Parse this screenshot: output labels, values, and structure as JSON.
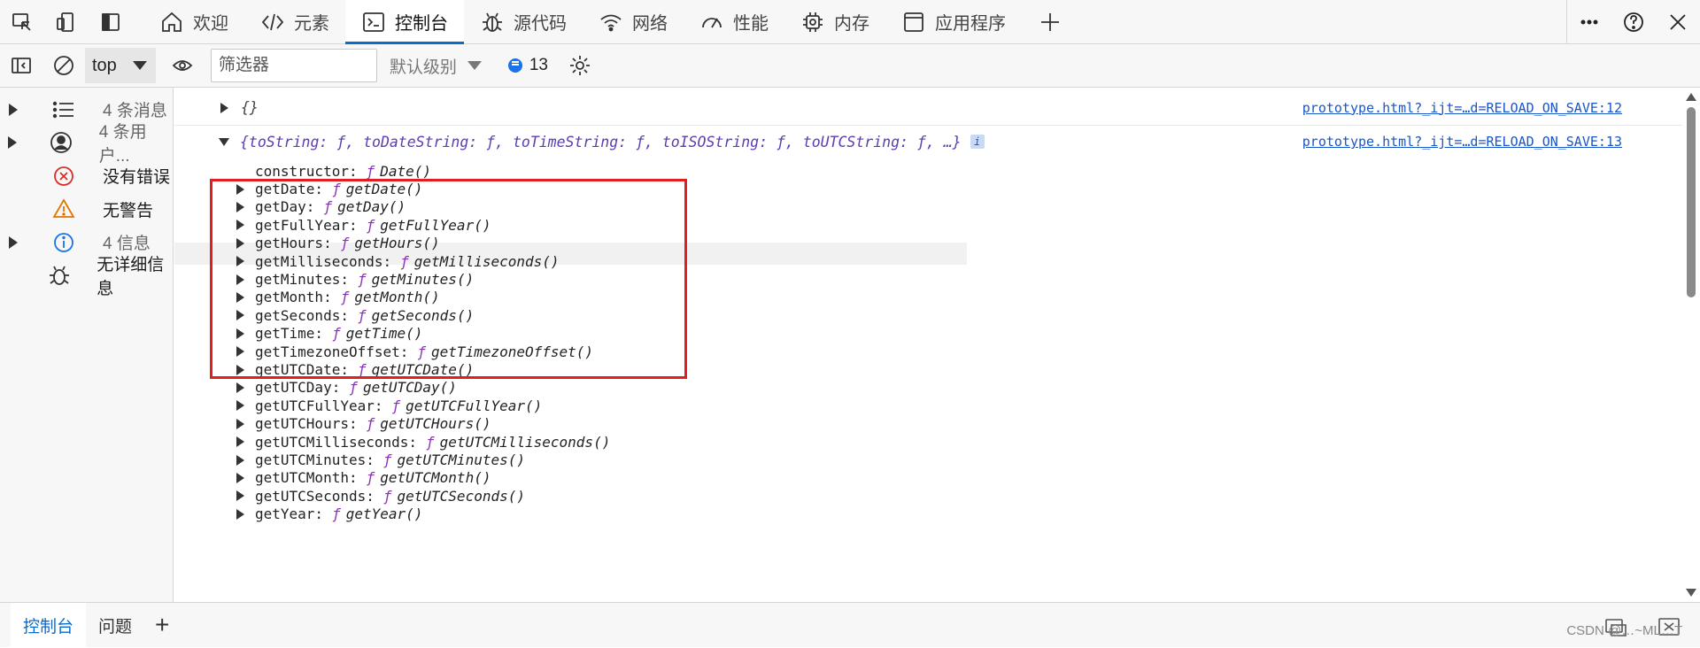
{
  "tabs": [
    {
      "label": "欢迎",
      "icon": "home-icon"
    },
    {
      "label": "元素",
      "icon": "code-icon"
    },
    {
      "label": "控制台",
      "icon": "console-icon",
      "active": true
    },
    {
      "label": "源代码",
      "icon": "bug-icon"
    },
    {
      "label": "网络",
      "icon": "wifi-icon"
    },
    {
      "label": "性能",
      "icon": "gauge-icon"
    },
    {
      "label": "内存",
      "icon": "chip-icon"
    },
    {
      "label": "应用程序",
      "icon": "window-icon"
    }
  ],
  "toolbar": {
    "context": "top",
    "filter_placeholder": "筛选器",
    "levels": "默认级别",
    "message_count": "13"
  },
  "sidebar": {
    "items": [
      {
        "label": "4 条消息",
        "icon": "list-icon",
        "expandable": true
      },
      {
        "label": "4 条用户...",
        "icon": "user-icon",
        "expandable": true
      },
      {
        "label": "没有错误",
        "icon": "error-icon",
        "expandable": false
      },
      {
        "label": "无警告",
        "icon": "warning-icon",
        "expandable": false
      },
      {
        "label": "4 信息",
        "icon": "info-icon",
        "expandable": true
      },
      {
        "label": "无详细信息",
        "icon": "bug-icon",
        "expandable": false
      }
    ]
  },
  "console": {
    "entries": [
      {
        "preview": "{}",
        "source": "prototype.html?_ijt=…d=RELOAD_ON_SAVE:12"
      },
      {
        "preview": "{toString: ƒ, toDateString: ƒ, toTimeString: ƒ, toISOString: ƒ, toUTCString: ƒ, …}",
        "source": "prototype.html?_ijt=…d=RELOAD_ON_SAVE:13"
      }
    ],
    "properties": [
      {
        "key": "constructor:",
        "fn": "Date()"
      },
      {
        "key": "getDate:",
        "fn": "getDate()"
      },
      {
        "key": "getDay:",
        "fn": "getDay()"
      },
      {
        "key": "getFullYear:",
        "fn": "getFullYear()"
      },
      {
        "key": "getHours:",
        "fn": "getHours()"
      },
      {
        "key": "getMilliseconds:",
        "fn": "getMilliseconds()"
      },
      {
        "key": "getMinutes:",
        "fn": "getMinutes()"
      },
      {
        "key": "getMonth:",
        "fn": "getMonth()"
      },
      {
        "key": "getSeconds:",
        "fn": "getSeconds()"
      },
      {
        "key": "getTime:",
        "fn": "getTime()"
      },
      {
        "key": "getTimezoneOffset:",
        "fn": "getTimezoneOffset()"
      },
      {
        "key": "getUTCDate:",
        "fn": "getUTCDate()"
      },
      {
        "key": "getUTCDay:",
        "fn": "getUTCDay()"
      },
      {
        "key": "getUTCFullYear:",
        "fn": "getUTCFullYear()"
      },
      {
        "key": "getUTCHours:",
        "fn": "getUTCHours()"
      },
      {
        "key": "getUTCMilliseconds:",
        "fn": "getUTCMilliseconds()"
      },
      {
        "key": "getUTCMinutes:",
        "fn": "getUTCMinutes()"
      },
      {
        "key": "getUTCMonth:",
        "fn": "getUTCMonth()"
      },
      {
        "key": "getUTCSeconds:",
        "fn": "getUTCSeconds()"
      },
      {
        "key": "getYear:",
        "fn": "getYear()"
      }
    ],
    "f_glyph": "ƒ",
    "info_badge": "i"
  },
  "bottom": {
    "tabs": [
      "控制台",
      "问题"
    ],
    "add": "+",
    "watermark": "CSDN @…~ML…T"
  },
  "colors": {
    "accent": "#0b6bcb",
    "highlight_box": "#e02020",
    "function_glyph": "#8a33b8"
  }
}
